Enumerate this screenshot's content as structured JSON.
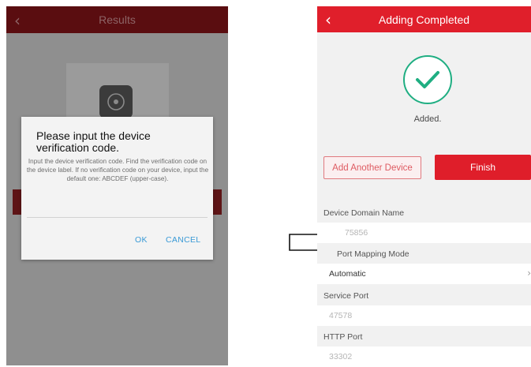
{
  "left_screen": {
    "header": {
      "back_icon": "chevron-left-icon",
      "title": "Results"
    },
    "device_icon": "camera-icon",
    "dialog": {
      "title": "Please input the device verification code.",
      "body": "Input the device verification code. Find the verification code on the device label. If no verification code on your device, input the default one: ABCDEF (upper-case).",
      "ok_label": "OK",
      "cancel_label": "CANCEL"
    }
  },
  "arrow_icon": "right-arrow-icon",
  "right_screen": {
    "header": {
      "back_icon": "chevron-left-icon",
      "title": "Adding Completed"
    },
    "status_icon": "checkmark-circle-icon",
    "status_text": "Added.",
    "add_another_label": "Add Another Device",
    "finish_label": "Finish",
    "fields": {
      "domain_label": "Device Domain Name",
      "domain_value": "75856",
      "port_mapping_label": "Port Mapping Mode",
      "port_mapping_value": "Automatic",
      "service_port_label": "Service Port",
      "service_port_value": "47578",
      "http_port_label": "HTTP Port",
      "http_port_value": "33302"
    },
    "colors": {
      "accent": "#e01f2b",
      "success": "#1fae82",
      "link": "#3a9ad6"
    }
  }
}
